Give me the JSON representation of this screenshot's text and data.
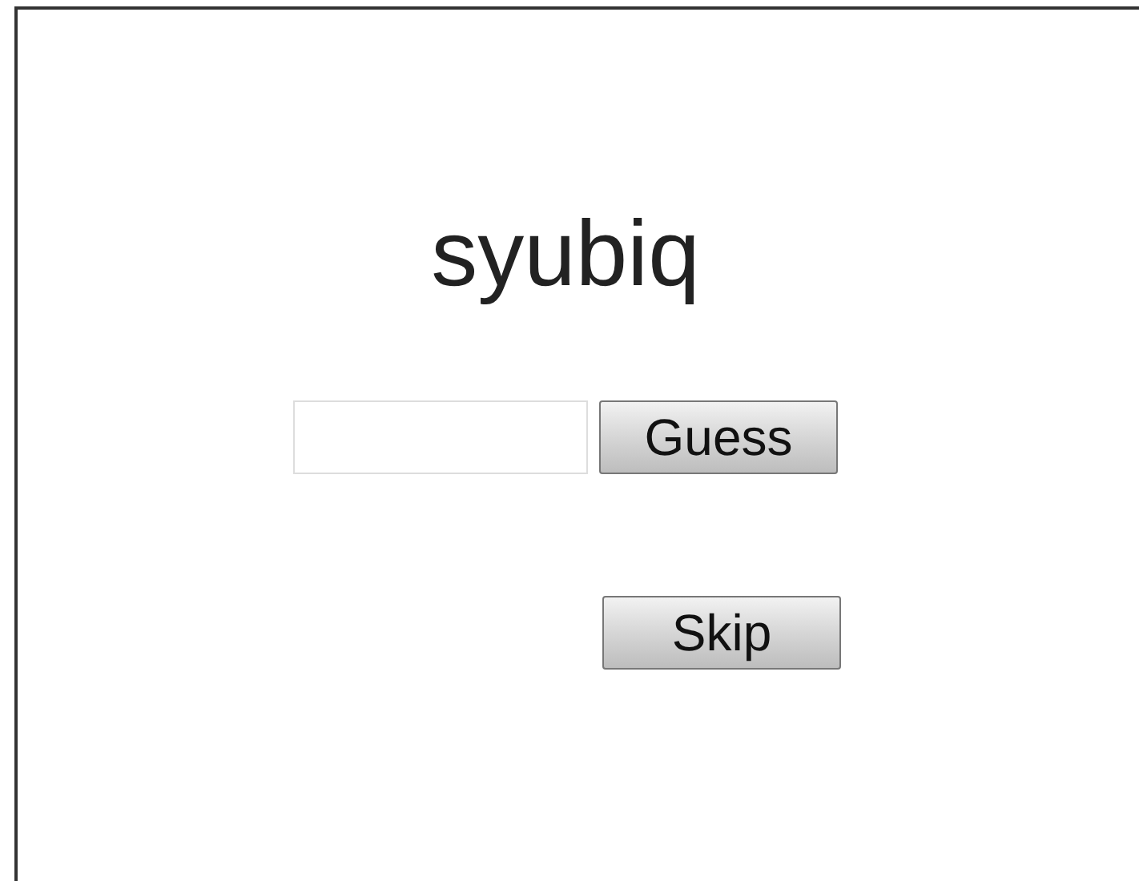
{
  "word": "syubiq",
  "guess": {
    "button": "Guess"
  },
  "skip_button": "Skip"
}
